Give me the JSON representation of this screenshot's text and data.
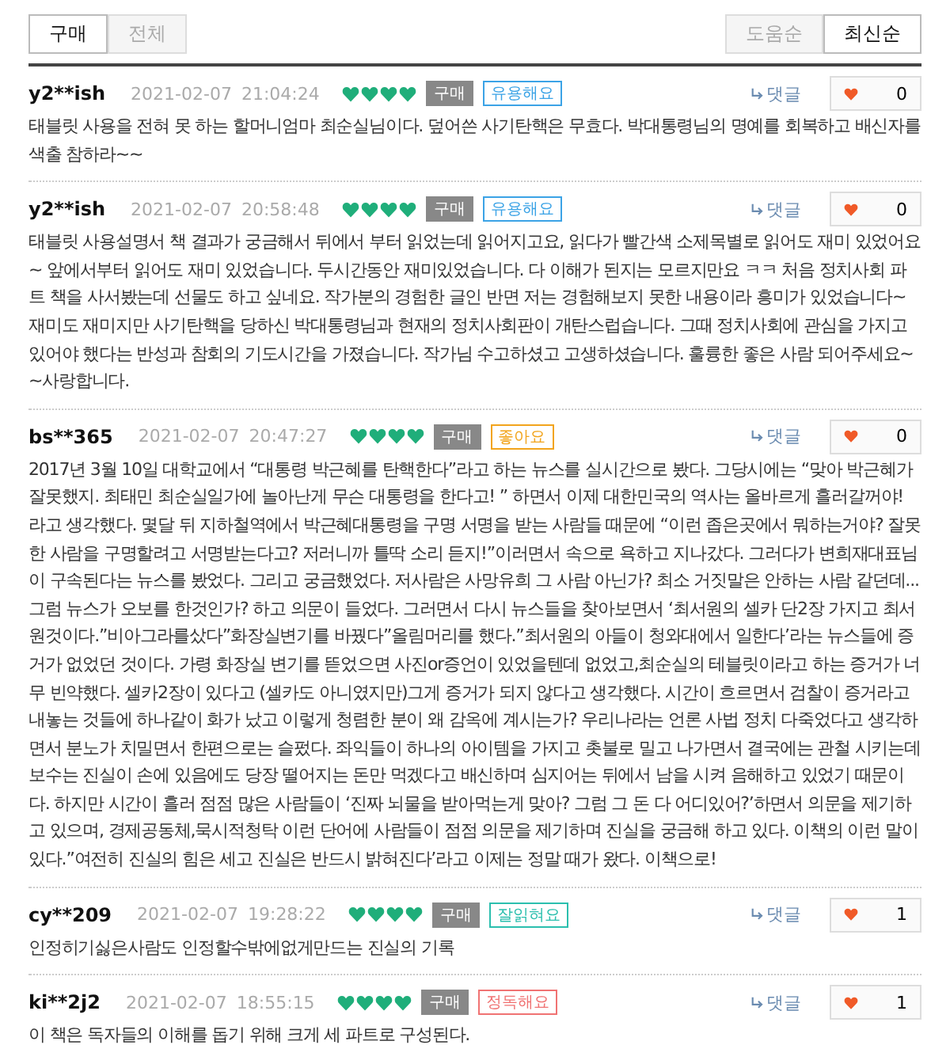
{
  "filter_tabs": [
    {
      "label": "구매",
      "selected": true
    },
    {
      "label": "전체",
      "selected": false
    }
  ],
  "sort_tabs": [
    {
      "label": "도움순",
      "selected": false
    },
    {
      "label": "최신순",
      "selected": true
    }
  ],
  "reviews": [
    {
      "user": "y2**ish",
      "date": "2021-02-07",
      "time": "21:04:24",
      "stars": 4,
      "badge": "구매",
      "tag": {
        "label": "유용해요",
        "color": "#3ba3e6"
      },
      "reply": "댓글",
      "likes": "0",
      "text": "태블릿 사용을 전혀 못 하는 할머니엄마 최순실님이다. 덮어쓴 사기탄핵은 무효다. 박대통령님의 명예를 회복하고 배신자를 색출 참하라~~"
    },
    {
      "user": "y2**ish",
      "date": "2021-02-07",
      "time": "20:58:48",
      "stars": 4,
      "badge": "구매",
      "tag": {
        "label": "유용해요",
        "color": "#3ba3e6"
      },
      "reply": "댓글",
      "likes": "0",
      "text": "태블릿 사용설명서 책 결과가 궁금해서 뒤에서 부터 읽었는데 읽어지고요, 읽다가 빨간색 소제목별로 읽어도 재미 있었어요~ 앞에서부터 읽어도 재미 있었습니다. 두시간동안 재미있었습니다. 다 이해가 된지는 모르지만요 ㅋㅋ 처음 정치사회 파트 책을 사서봤는데 선물도 하고 싶네요. 작가분의 경험한 글인 반면 저는 경험해보지 못한 내용이라 흥미가 있었습니다~ 재미도 재미지만 사기탄핵을 당하신 박대통령님과 현재의 정치사회판이 개탄스럽습니다. 그때 정치사회에 관심을 가지고 있어야 했다는 반성과 참회의 기도시간을 가졌습니다. 작가님 수고하셨고 고생하셨습니다. 훌륭한 좋은 사람 되어주세요~~사랑합니다."
    },
    {
      "user": "bs**365",
      "date": "2021-02-07",
      "time": "20:47:27",
      "stars": 4,
      "badge": "구매",
      "tag": {
        "label": "좋아요",
        "color": "#f2a41c"
      },
      "reply": "댓글",
      "likes": "0",
      "text": "2017년 3월 10일 대학교에서 “대통령 박근혜를 탄핵한다”라고 하는 뉴스를 실시간으로 봤다. 그당시에는 “맞아 박근혜가 잘못했지. 최태민 최순실일가에 놀아난게 무슨 대통령을 한다고! ” 하면서 이제 대한민국의 역사는 올바르게 흘러갈꺼야! 라고 생각했다. 몇달 뒤 지하철역에서 박근혜대통령을 구명 서명을 받는 사람들 때문에 “이런 좁은곳에서 뭐하는거야? 잘못한 사람을 구명할려고 서명받는다고? 저러니까 틀딱 소리 듣지!”이러면서 속으로 욕하고 지나갔다. 그러다가 변희재대표님이 구속된다는 뉴스를 봤었다. 그리고 궁금했었다. 저사람은 사망유희 그 사람 아닌가? 최소 거짓말은 안하는 사람 같던데... 그럼 뉴스가 오보를 한것인가? 하고 의문이 들었다. 그러면서 다시 뉴스들을 찾아보면서 ‘최서원의 셀카 단2장 가지고 최서원것이다.”비아그라를샀다”화장실변기를 바꿨다”올림머리를 했다.”최서원의 아들이 청와대에서 일한다’라는 뉴스들에 증거가 없었던 것이다. 가령 화장실 변기를 뜯었으면 사진or증언이 있었을텐데 없었고,최순실의 테블릿이라고 하는 증거가 너무 빈약했다. 셀카2장이 있다고 (셀카도 아니였지만)그게 증거가 되지 않다고 생각했다. 시간이 흐르면서 검찰이 증거라고 내놓는 것들에 하나같이 화가 났고 이렇게 청렴한 분이 왜 감옥에 계시는가? 우리나라는 언론 사법 정치 다죽었다고 생각하면서 분노가 치밀면서 한편으로는 슬펐다. 좌익들이 하나의 아이템을 가지고 촛불로 밀고 나가면서 결국에는 관철 시키는데 보수는 진실이 손에 있음에도 당장 떨어지는 돈만 먹겠다고 배신하며 심지어는 뒤에서 남을 시켜 음해하고 있었기 때문이다. 하지만 시간이 흘러 점점 많은 사람들이 ‘진짜 뇌물을 받아먹는게 맞아? 그럼 그 돈 다 어디있어?’하면서 의문을 제기하고 있으며, 경제공동체,묵시적청탁 이런 단어에 사람들이 점점 의문을 제기하며 진실을 궁금해 하고 있다. 이책의 이런 말이 있다.”여전히 진실의 힘은 세고 진실은 반드시 밝혀진다’라고 이제는 정말 때가 왔다. 이책으로!"
    },
    {
      "user": "cy**209",
      "date": "2021-02-07",
      "time": "19:28:22",
      "stars": 4,
      "badge": "구매",
      "tag": {
        "label": "잘읽혀요",
        "color": "#2bbfae"
      },
      "reply": "댓글",
      "likes": "1",
      "text": "인정히기싫은사람도 인정할수밖에없게만드는 진실의 기록"
    },
    {
      "user": "ki**2j2",
      "date": "2021-02-07",
      "time": "18:55:15",
      "stars": 4,
      "badge": "구매",
      "tag": {
        "label": "정독해요",
        "color": "#f07373"
      },
      "reply": "댓글",
      "likes": "1",
      "text": "이 책은 독자들의 이해를 돕기 위해 크게 세 파트로 구성된다."
    }
  ]
}
